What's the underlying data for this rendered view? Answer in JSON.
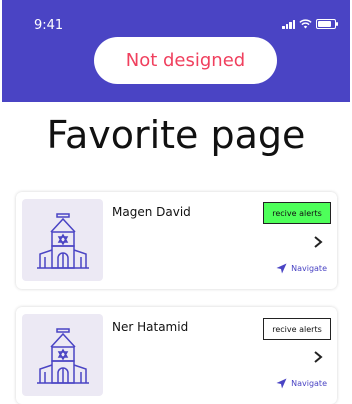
{
  "status_bar": {
    "time": "9:41"
  },
  "header": {
    "pill_text": "Not designed"
  },
  "page": {
    "title": "Favorite page"
  },
  "favorites": [
    {
      "name": "Magen David",
      "alert_label": "recive alerts",
      "alert_active": true,
      "navigate_label": "Navigate"
    },
    {
      "name": "Ner Hatamid",
      "alert_label": "recive alerts",
      "alert_active": false,
      "navigate_label": "Navigate"
    }
  ],
  "colors": {
    "header_bg": "#4a44c4",
    "pill_text": "#f0405e",
    "alert_active_bg": "#4eff5a",
    "thumb_bg": "#ece9f4",
    "accent": "#4a44c4"
  },
  "icons": {
    "status": [
      "signal-icon",
      "wifi-icon",
      "battery-icon"
    ],
    "thumb": "synagogue-icon",
    "chevron": "chevron-right-icon",
    "navigate": "navigation-arrow-icon"
  }
}
